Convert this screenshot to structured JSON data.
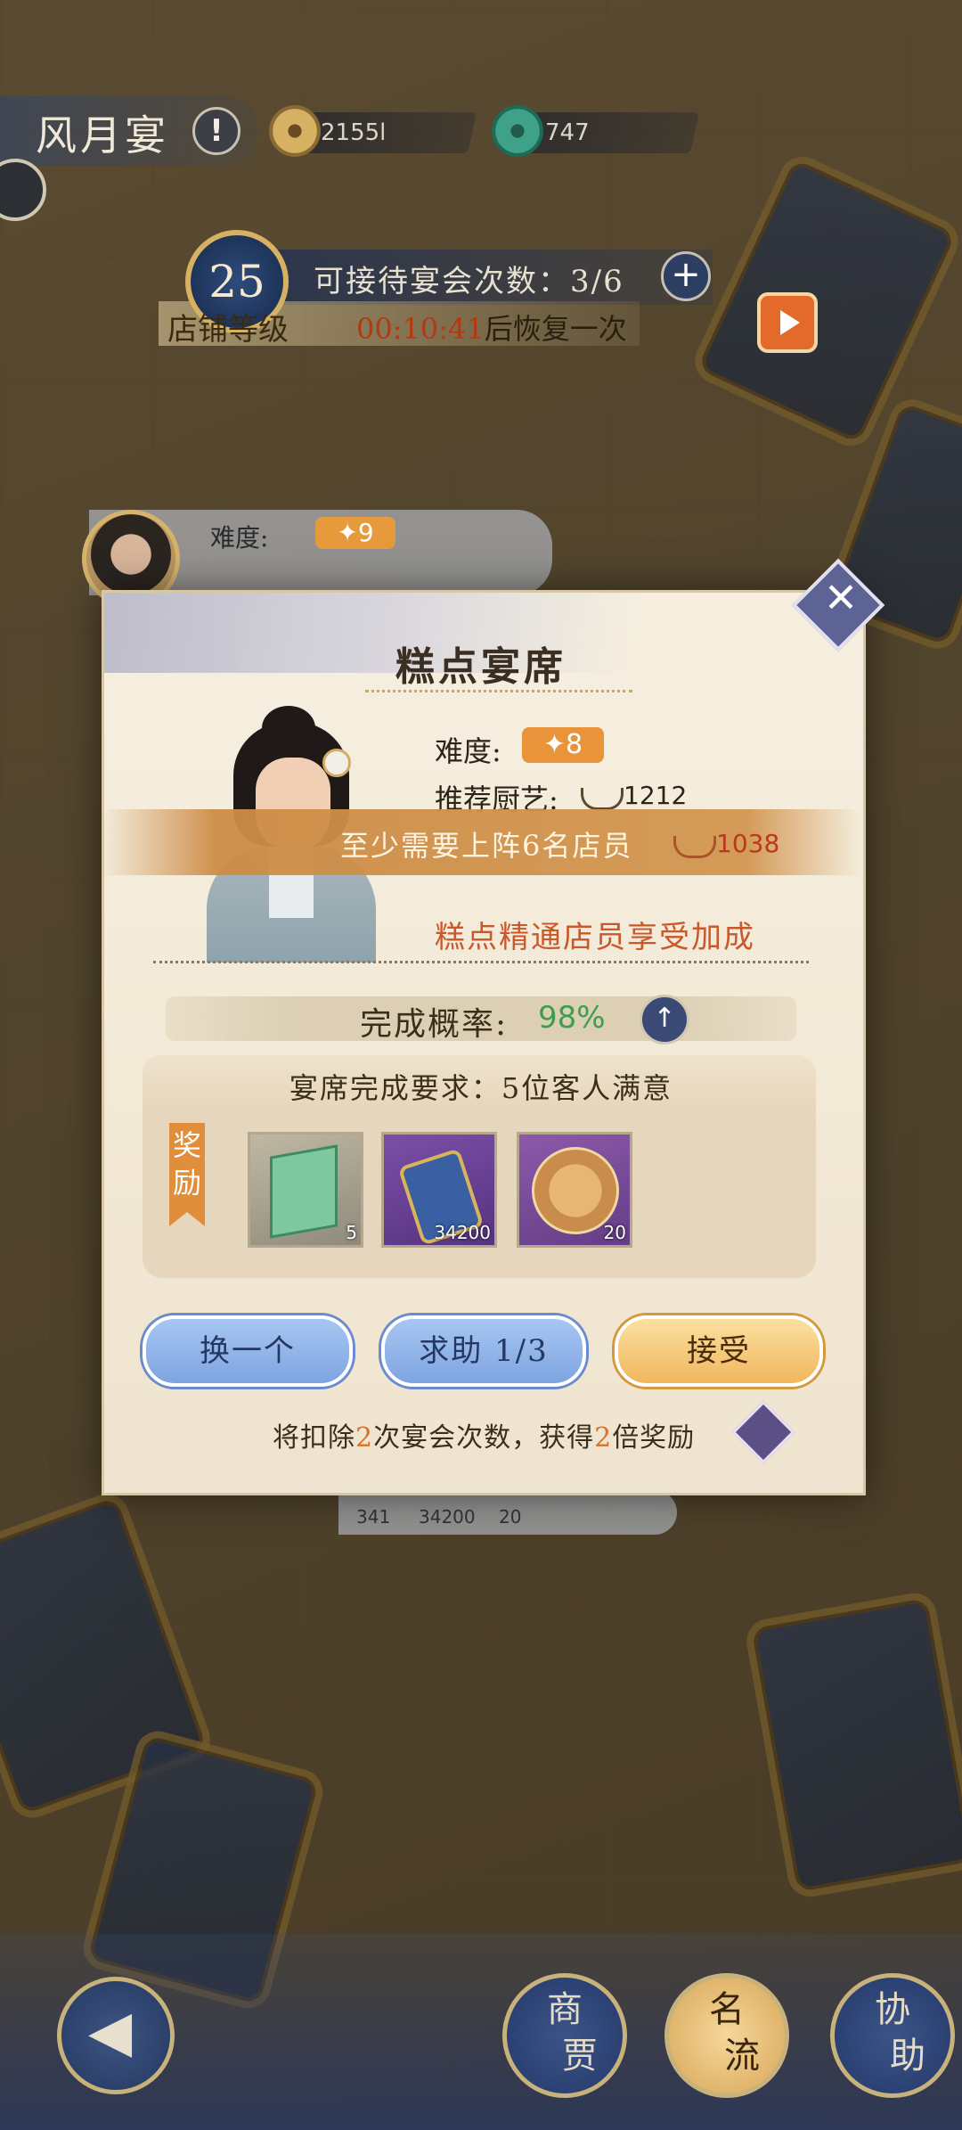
{
  "header": {
    "title": "风月宴",
    "coins": "2155l",
    "jade": "747"
  },
  "shop": {
    "level": "25",
    "level_label": "店铺等级",
    "banquet_count": "可接待宴会次数：3/6",
    "recover_time": "00:10:41",
    "recover_suffix": "后恢复一次"
  },
  "under_card": {
    "difficulty_label": "难度:",
    "difficulty": "✦9",
    "item_counts": [
      "341",
      "34200",
      "20"
    ]
  },
  "modal": {
    "title": "糕点宴席",
    "difficulty_label": "难度:",
    "difficulty": "✦8",
    "recommended_label": "推荐厨艺:",
    "recommended_value": "1212",
    "staff_requirement": "至少需要上阵6名店员",
    "current_skill": "1038",
    "bonus_text": "糕点精通店员享受加成",
    "probability_label": "完成概率:",
    "probability_value": "98%",
    "requirement_text": "宴席完成要求：5位客人满意",
    "reward_label": "奖励",
    "rewards": [
      {
        "icon": "book-icon",
        "count": "5"
      },
      {
        "icon": "tag-icon",
        "count": "34200"
      },
      {
        "icon": "teapot-icon",
        "count": "20"
      }
    ],
    "buttons": {
      "change": "换一个",
      "help": "求助 1/3",
      "accept": "接受"
    },
    "deduct_prefix": "将扣除",
    "deduct_n1": "2",
    "deduct_mid": "次宴会次数，获得",
    "deduct_n2": "2",
    "deduct_suffix": "倍奖励"
  },
  "nav": {
    "merchant": [
      "商",
      "贾"
    ],
    "celebrity": [
      "名",
      "流"
    ],
    "assist": [
      "协",
      "助"
    ]
  },
  "colors": {
    "accent_orange": "#e9943a",
    "success_green": "#3f9d4f",
    "highlight": "#d9732a"
  }
}
